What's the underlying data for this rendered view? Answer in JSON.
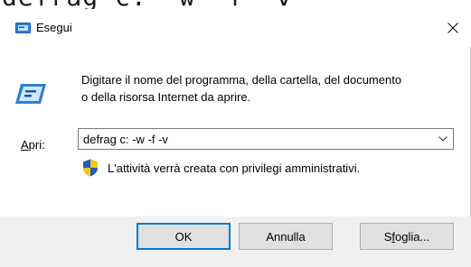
{
  "background_text": "defrag c: -w -f -v",
  "dialog": {
    "title": "Esegui",
    "description": "Digitare il nome del programma, della cartella, del documento o della risorsa Internet da aprire.",
    "open_label": {
      "accel": "A",
      "rest": "pri:"
    },
    "command_value": "defrag c: -w -f -v",
    "admin_note": "L'attività verrà creata con privilegi amministrativi.",
    "buttons": {
      "ok": "OK",
      "cancel": "Annulla",
      "browse": {
        "before": "S",
        "accel": "f",
        "after": "oglia..."
      }
    }
  },
  "colors": {
    "accent": "#0078d7",
    "footer_bg": "#f0f0f0",
    "shield_blue": "#1e5fb4",
    "shield_yellow": "#f5c518"
  },
  "icons": {
    "title": "run-icon",
    "main": "run-icon",
    "close": "close-icon",
    "dropdown": "chevron-down-icon",
    "admin": "uac-shield-icon"
  }
}
